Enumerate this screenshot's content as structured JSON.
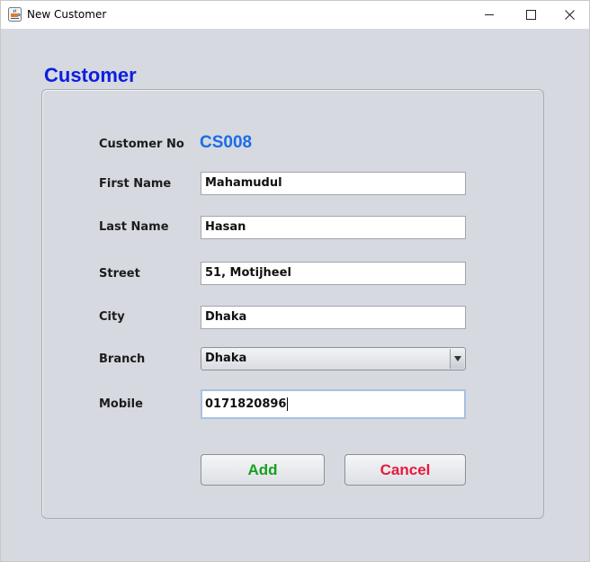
{
  "window": {
    "title": "New Customer",
    "icon": "java-coffee-icon"
  },
  "form": {
    "heading": "Customer",
    "customer_no": {
      "label": "Customer No",
      "value": "CS008"
    },
    "first_name": {
      "label": "First Name",
      "value": "Mahamudul"
    },
    "last_name": {
      "label": "Last Name",
      "value": "Hasan"
    },
    "street": {
      "label": "Street",
      "value": "51, Motijheel"
    },
    "city": {
      "label": "City",
      "value": "Dhaka"
    },
    "branch": {
      "label": "Branch",
      "selected": "Dhaka"
    },
    "mobile": {
      "label": "Mobile",
      "value": "0171820896"
    }
  },
  "buttons": {
    "add_label": "Add",
    "cancel_label": "Cancel"
  },
  "colors": {
    "heading": "#0d1ee0",
    "customer_no": "#1a6de6",
    "add": "#17a01d",
    "cancel": "#e8183d",
    "background": "#d6d9df"
  }
}
